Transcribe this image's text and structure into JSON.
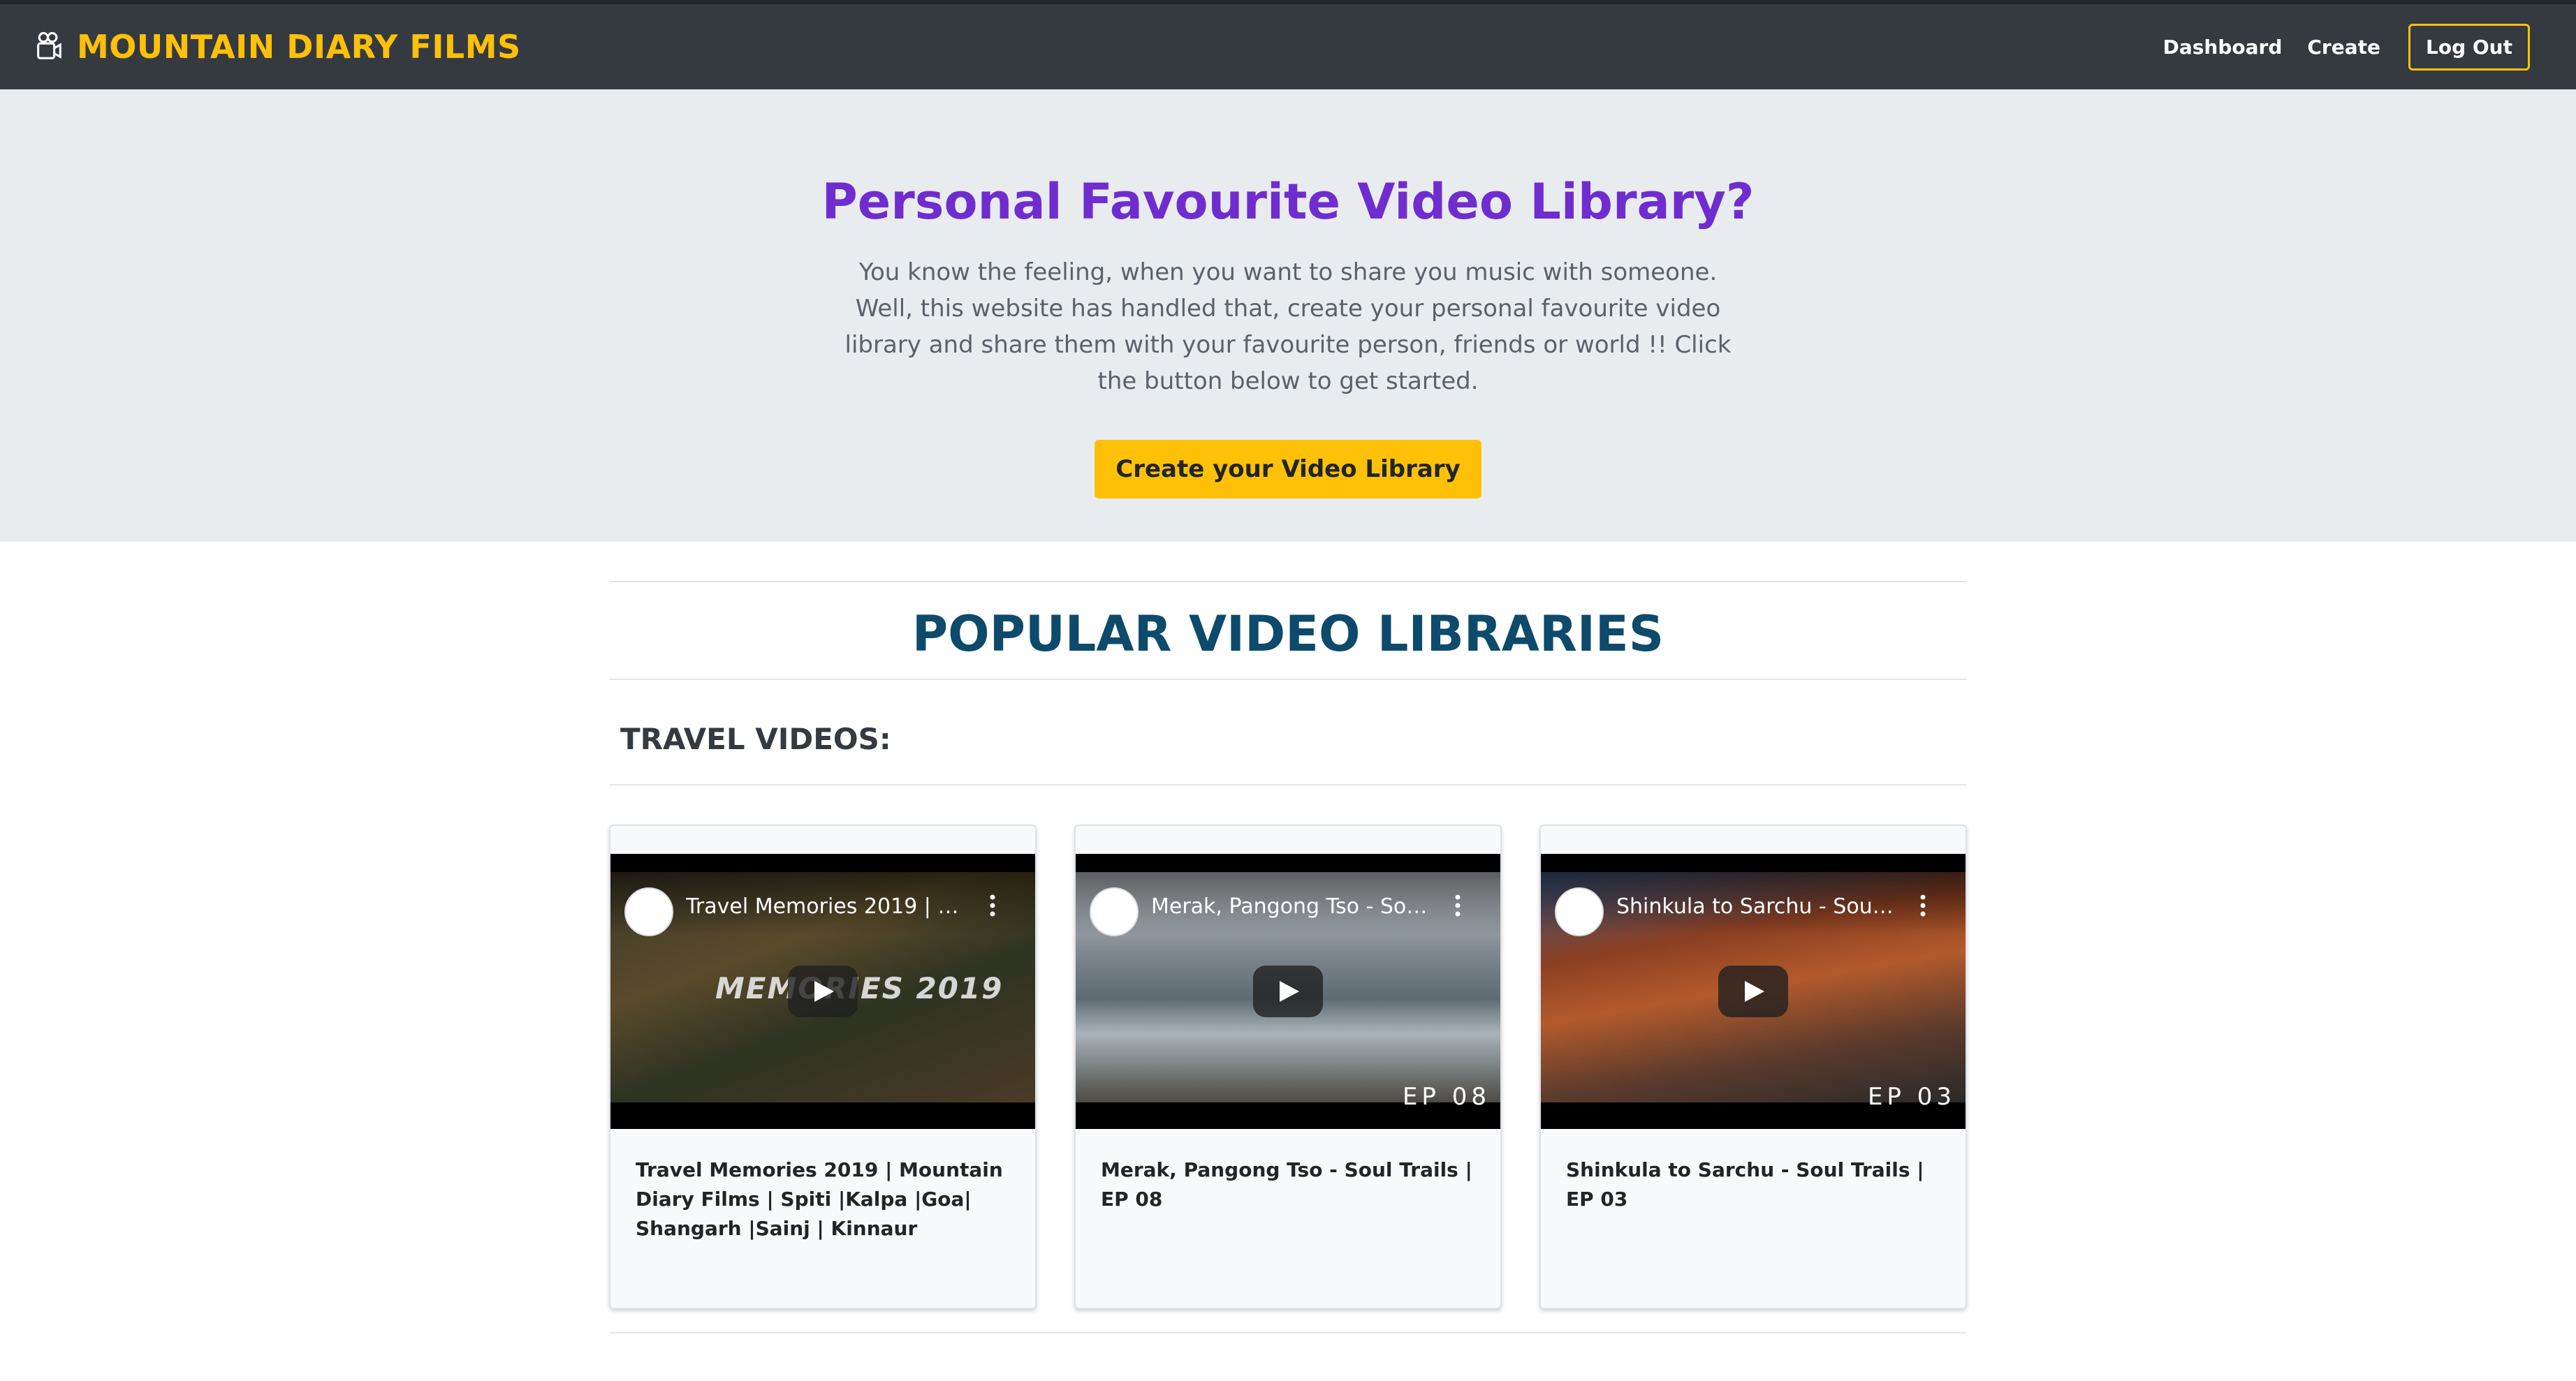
{
  "navbar": {
    "brand": "MOUNTAIN DIARY FILMS",
    "brand_icon": "film-camera-icon",
    "links": [
      "Dashboard",
      "Create"
    ],
    "logout": "Log Out"
  },
  "hero": {
    "title": "Personal Favourite Video Library?",
    "text": "You know the feeling, when you want to share you music with someone. Well, this website has handled that, create your personal favourite video library and share them with your favourite person, friends or world !! Click the button below to get started.",
    "cta": "Create your Video Library"
  },
  "popular": {
    "title": "POPULAR VIDEO LIBRARIES",
    "category": "TRAVEL VIDEOS:",
    "cards": [
      {
        "video_title": "Travel Memories 2019 | M...",
        "overlay_text": "MEMORIES 2019",
        "ep_badge": "",
        "title": "Travel Memories 2019 | Mountain Diary Films | Spiti |Kalpa |Goa| Shangarh |Sainj | Kinnaur"
      },
      {
        "video_title": "Merak, Pangong Tso - Soul...",
        "overlay_text": "",
        "ep_badge": "EP 08",
        "title": "Merak, Pangong Tso - Soul Trails | EP 08"
      },
      {
        "video_title": "Shinkula to Sarchu - Soul T...",
        "overlay_text": "",
        "ep_badge": "EP 03",
        "title": "Shinkula to Sarchu - Soul Trails | EP 03"
      }
    ]
  },
  "colors": {
    "navbar_bg": "#343a40",
    "brand": "#ffc107",
    "hero_title": "#6f2dcf",
    "section_title": "#0d4a6b"
  }
}
